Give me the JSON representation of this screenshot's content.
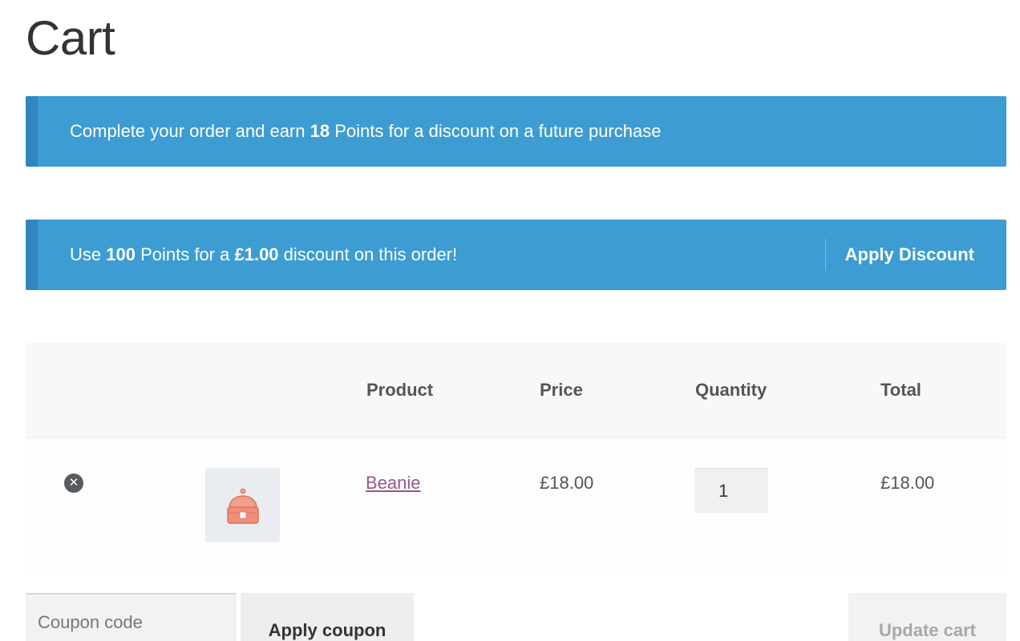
{
  "page": {
    "title": "Cart"
  },
  "notices": {
    "earn": {
      "prefix": "Complete your order and earn ",
      "points": "18",
      "suffix": " Points for a discount on a future purchase"
    },
    "redeem": {
      "prefix": "Use ",
      "points": "100",
      "middle": " Points for a ",
      "amount": "£1.00",
      "suffix": " discount on this order!",
      "action_label": "Apply Discount"
    },
    "color": "#3d9cd2",
    "border_color": "#2f87bd"
  },
  "cart": {
    "headers": {
      "product": "Product",
      "price": "Price",
      "quantity": "Quantity",
      "total": "Total"
    },
    "items": [
      {
        "remove_icon": "close-circle-icon",
        "thumbnail_icon": "beanie-icon",
        "name": "Beanie",
        "price": "£18.00",
        "quantity": "1",
        "subtotal": "£18.00"
      }
    ]
  },
  "actions": {
    "coupon_placeholder": "Coupon code",
    "apply_coupon_label": "Apply coupon",
    "update_cart_label": "Update cart"
  },
  "colors": {
    "link": "#96588a",
    "header_bg": "#f8f8f8"
  }
}
